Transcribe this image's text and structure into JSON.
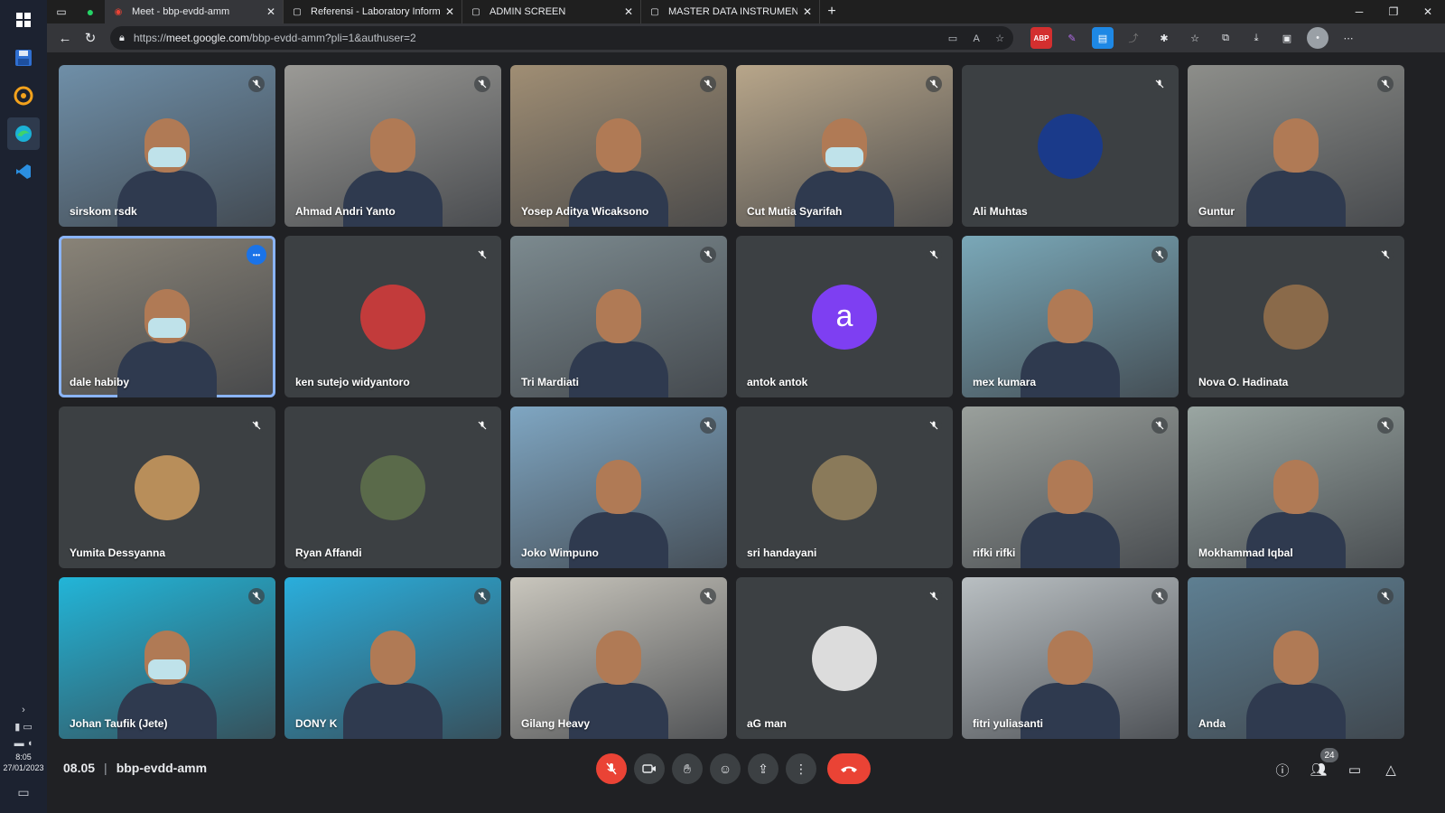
{
  "taskbar": {
    "time": "8:05",
    "date": "27/01/2023",
    "chevron": "›"
  },
  "browser": {
    "tabs": [
      {
        "title": "Meet - bbp-evdd-amm",
        "active": true
      },
      {
        "title": "Referensi - Laboratory Informatio",
        "active": false
      },
      {
        "title": "ADMIN SCREEN",
        "active": false
      },
      {
        "title": "MASTER DATA INSTRUMENTMET",
        "active": false
      }
    ],
    "url_prefix": "https://",
    "url_domain": "meet.google.com",
    "url_path": "/bbp-evdd-amm?pli=1&authuser=2",
    "extensions": [
      "ABP"
    ]
  },
  "participants": [
    {
      "name": "sirskom rsdk",
      "type": "video",
      "color": "#6f8fa8"
    },
    {
      "name": "Ahmad Andri Yanto",
      "type": "video",
      "color": "#9b9a96"
    },
    {
      "name": "Yosep Aditya Wicaksono",
      "type": "video",
      "color": "#a08e74"
    },
    {
      "name": "Cut Mutia Syarifah",
      "type": "video",
      "color": "#b8a68a"
    },
    {
      "name": "Ali Muhtas",
      "type": "avatar",
      "color": "#1a3a8a"
    },
    {
      "name": "Guntur",
      "type": "video",
      "color": "#8d8e8a"
    },
    {
      "name": "dale habiby",
      "type": "video",
      "color": "#8a8478",
      "pinned": true
    },
    {
      "name": "ken sutejo widyantoro",
      "type": "avatar",
      "color": "#c23b3b"
    },
    {
      "name": "Tri Mardiati",
      "type": "video",
      "color": "#7c8a8f"
    },
    {
      "name": "antok antok",
      "type": "letter",
      "letter": "a",
      "color": "#7e3ff2"
    },
    {
      "name": "mex kumara",
      "type": "video",
      "color": "#7aa8b8"
    },
    {
      "name": "Nova O. Hadinata",
      "type": "avatar",
      "color": "#8a6a4a"
    },
    {
      "name": "Yumita Dessyanna",
      "type": "avatar",
      "color": "#b88e5a"
    },
    {
      "name": "Ryan Affandi",
      "type": "avatar",
      "color": "#5a6a4a"
    },
    {
      "name": "Joko Wimpuno",
      "type": "video",
      "color": "#7fa6c2"
    },
    {
      "name": "sri handayani",
      "type": "avatar",
      "color": "#8a7a5a"
    },
    {
      "name": "rifki rifki",
      "type": "video",
      "color": "#9aa09c"
    },
    {
      "name": "Mokhammad Iqbal",
      "type": "video",
      "color": "#9aa6a2"
    },
    {
      "name": "Johan Taufik (Jete)",
      "type": "video",
      "color": "#22b5d8"
    },
    {
      "name": "DONY K",
      "type": "video",
      "color": "#2aaedc"
    },
    {
      "name": "Gilang Heavy",
      "type": "video",
      "color": "#c9c6bd"
    },
    {
      "name": "aG man",
      "type": "avatar",
      "color": "#dcdcdc"
    },
    {
      "name": "fitri yuliasanti",
      "type": "video",
      "color": "#b9bfc2"
    },
    {
      "name": "Anda",
      "type": "video",
      "color": "#5e7f92"
    }
  ],
  "meeting": {
    "time": "08.05",
    "separator": "|",
    "code": "bbp-evdd-amm",
    "participant_count": "24"
  },
  "icons": {
    "mic_off": "mic-off-icon",
    "camera": "camera-icon",
    "hand": "raise-hand-icon",
    "emoji": "emoji-icon",
    "present": "present-icon",
    "more": "more-options-icon",
    "end": "end-call-icon",
    "info": "info-icon",
    "people": "people-icon",
    "chat": "chat-icon",
    "activities": "activities-icon"
  }
}
